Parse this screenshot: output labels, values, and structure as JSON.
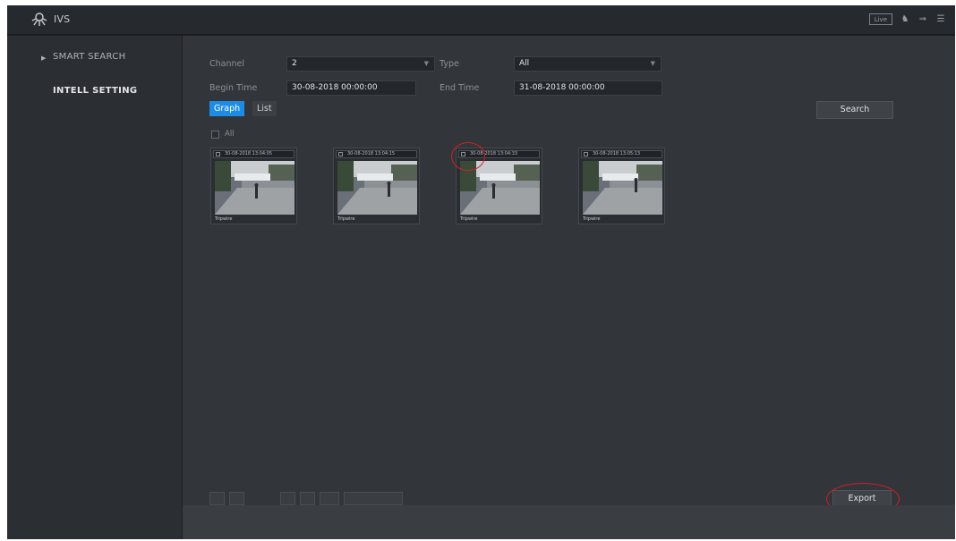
{
  "app": {
    "title": "IVS",
    "live_label": "Live"
  },
  "sidebar": {
    "items": [
      {
        "label": "SMART SEARCH"
      },
      {
        "label": "INTELL SETTING"
      }
    ]
  },
  "filters": {
    "channel_label": "Channel",
    "channel_value": "2",
    "type_label": "Type",
    "type_value": "All",
    "begin_label": "Begin Time",
    "begin_value": "30-08-2018   00:00:00",
    "end_label": "End Time",
    "end_value": "31-08-2018   00:00:00"
  },
  "view": {
    "graph_label": "Graph",
    "list_label": "List"
  },
  "search_label": "Search",
  "select_all_label": "All",
  "results": [
    {
      "time": "30-08-2018 13:04:05",
      "tag": "Tripwire"
    },
    {
      "time": "30-08-2018 13:04:15",
      "tag": "Tripwire"
    },
    {
      "time": "30-08-2018 13:04:33",
      "tag": "Tripwire"
    },
    {
      "time": "30-08-2018 13:05:13",
      "tag": "Tripwire"
    }
  ],
  "export_label": "Export",
  "colors": {
    "accent": "#1e8ce4",
    "annotation": "#d71e2a",
    "background": "#323539",
    "sidebar": "#2b2e33"
  }
}
